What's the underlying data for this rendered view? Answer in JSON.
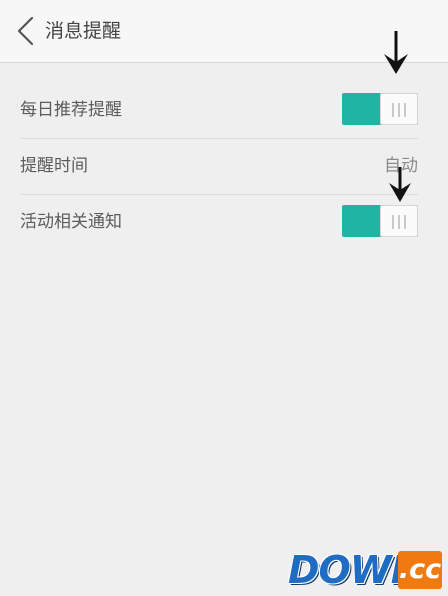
{
  "header": {
    "back_icon": "chevron-left-icon",
    "title": "消息提醒"
  },
  "settings": [
    {
      "label": "每日推荐提醒",
      "type": "toggle",
      "on": true
    },
    {
      "label": "提醒时间",
      "type": "value",
      "value": "自动"
    },
    {
      "label": "活动相关通知",
      "type": "toggle",
      "on": true
    }
  ],
  "colors": {
    "toggle_on": "#1fb5a2",
    "background": "#efefef",
    "header_bg": "#f7f7f7"
  },
  "annotations": {
    "arrow_icon": "down-arrow-icon"
  },
  "watermark": {
    "part1": "DOWN",
    "part2": ".cc"
  }
}
